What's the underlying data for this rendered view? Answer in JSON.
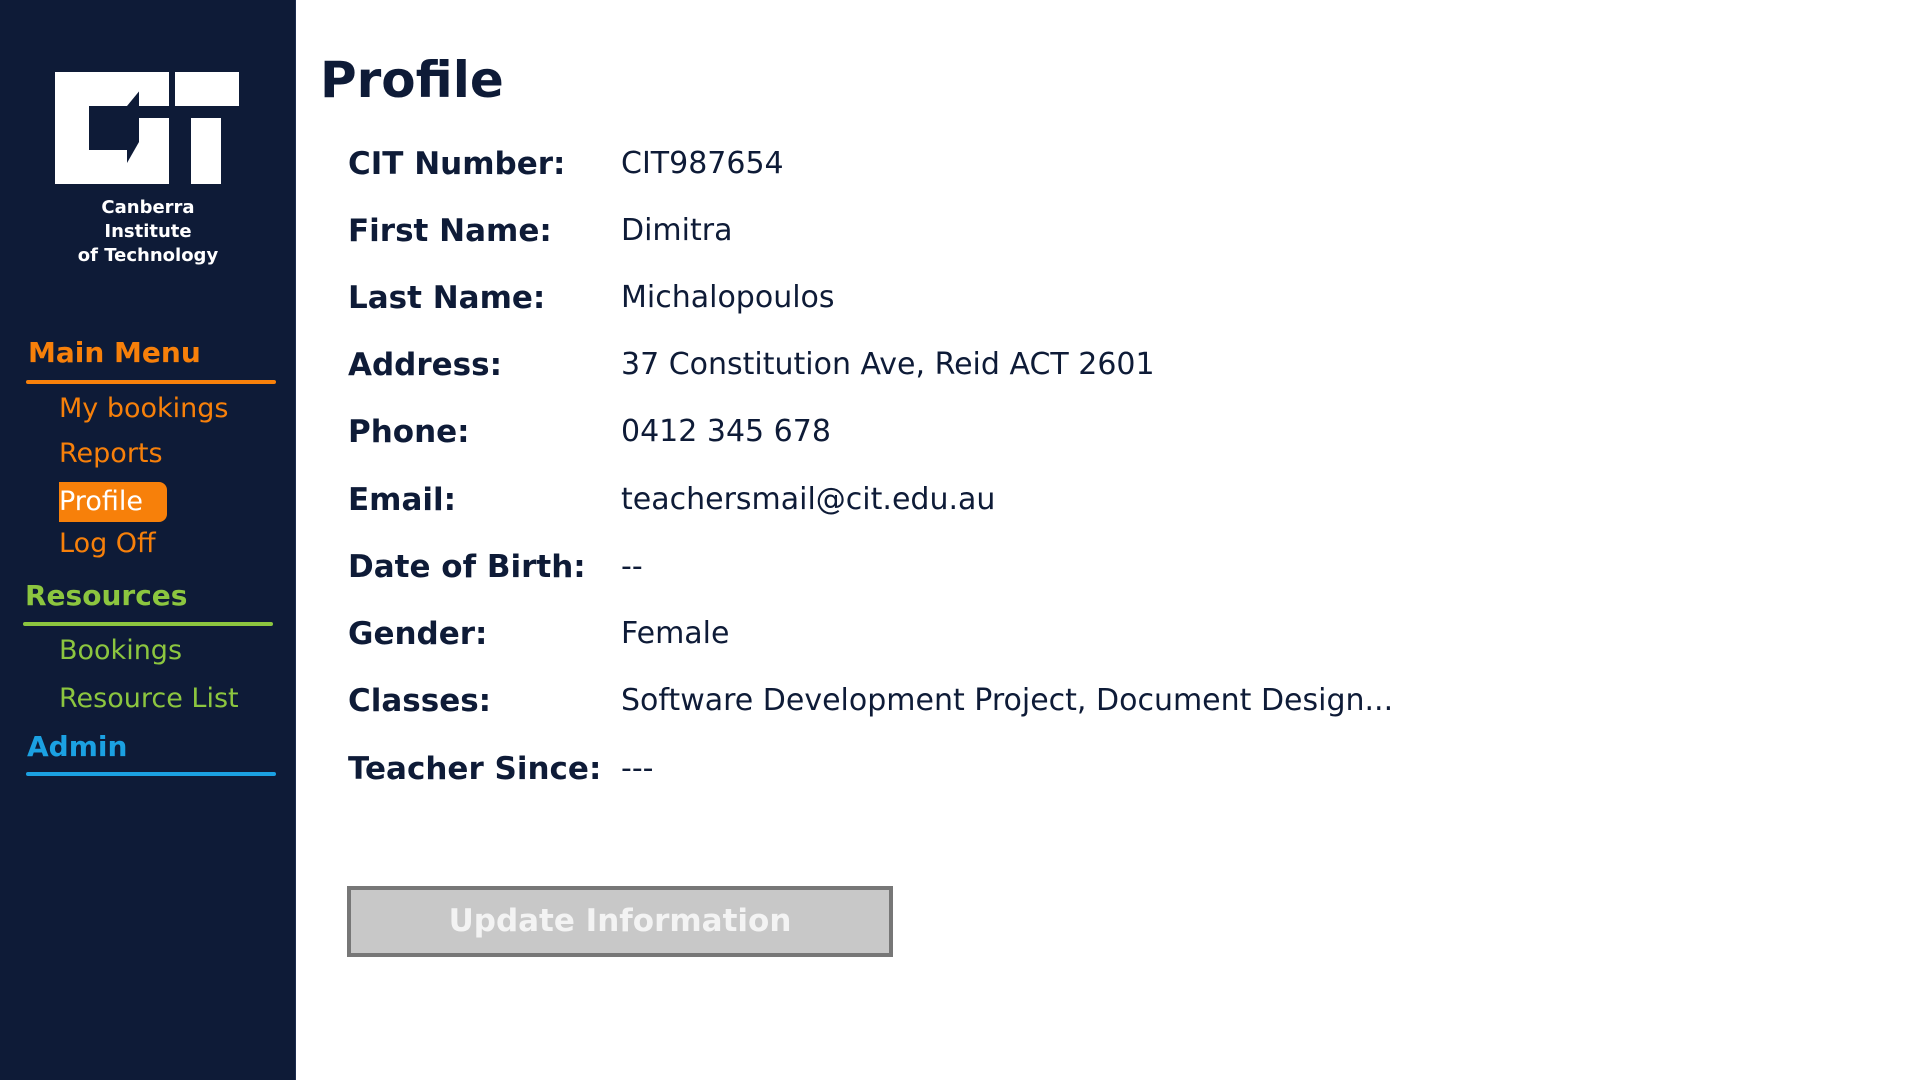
{
  "logo": {
    "line1": "Canberra Institute",
    "line2": "of Technology"
  },
  "sidebar": {
    "main_menu": {
      "label": "Main Menu",
      "color": "#f7800a",
      "items": [
        {
          "label": "My bookings"
        },
        {
          "label": "Reports"
        },
        {
          "label": "Profile",
          "active": true
        },
        {
          "label": "Log Off"
        }
      ]
    },
    "resources": {
      "label": "Resources",
      "color": "#8cc63f",
      "items": [
        {
          "label": "Bookings"
        },
        {
          "label": "Resource List"
        }
      ]
    },
    "admin": {
      "label": "Admin",
      "color": "#1ba1e2"
    }
  },
  "page": {
    "title": "Profile"
  },
  "profile": {
    "fields": [
      {
        "label": "CIT Number:",
        "value": "CIT987654"
      },
      {
        "label": "First Name:",
        "value": "Dimitra"
      },
      {
        "label": "Last Name:",
        "value": "Michalopoulos"
      },
      {
        "label": "Address:",
        "value": "37 Constitution Ave, Reid ACT 2601"
      },
      {
        "label": "Phone:",
        "value": "0412 345 678"
      },
      {
        "label": "Email:",
        "value": "teachersmail@cit.edu.au"
      },
      {
        "label": "Date of Birth:",
        "value": "--"
      },
      {
        "label": "Gender:",
        "value": "Female"
      },
      {
        "label": "Classes:",
        "value": "Software Development Project, Document Design..."
      },
      {
        "label": "Teacher Since:",
        "value": "---"
      }
    ]
  },
  "actions": {
    "update_label": "Update Information"
  },
  "colors": {
    "sidebar_bg": "#0e1b37",
    "text_dark": "#0e1b37",
    "button_bg": "#c8c8c8",
    "button_border": "#777777"
  }
}
